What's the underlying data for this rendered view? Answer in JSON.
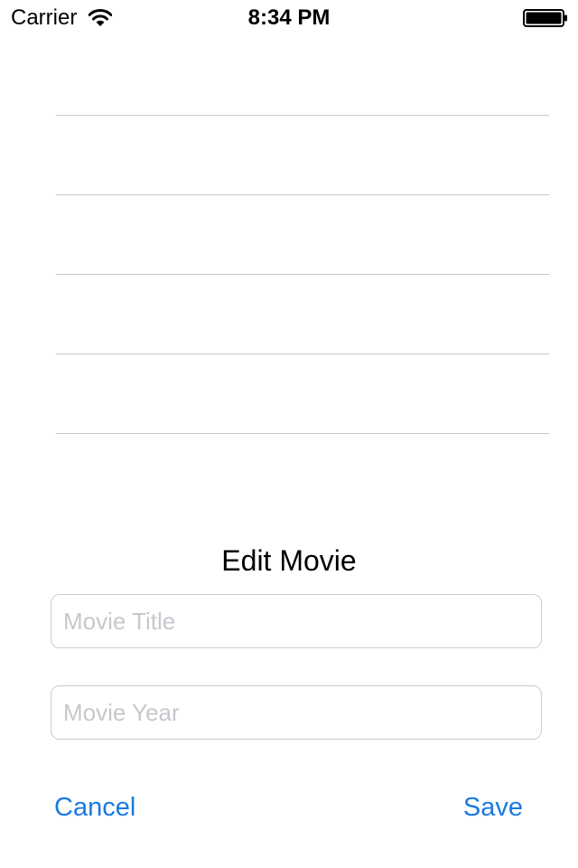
{
  "status_bar": {
    "carrier": "Carrier",
    "time": "8:34 PM",
    "icons": [
      "wifi-icon",
      "battery-icon"
    ]
  },
  "table": {
    "row_count": 5
  },
  "form": {
    "title": "Edit Movie",
    "movie_title": {
      "value": "",
      "placeholder": "Movie Title"
    },
    "movie_year": {
      "value": "",
      "placeholder": "Movie Year"
    },
    "cancel_label": "Cancel",
    "save_label": "Save"
  },
  "colors": {
    "tint": "#1a7ae0",
    "separator": "#c8c7cc",
    "placeholder": "#c7c7cd",
    "field_border": "#cccccc"
  }
}
